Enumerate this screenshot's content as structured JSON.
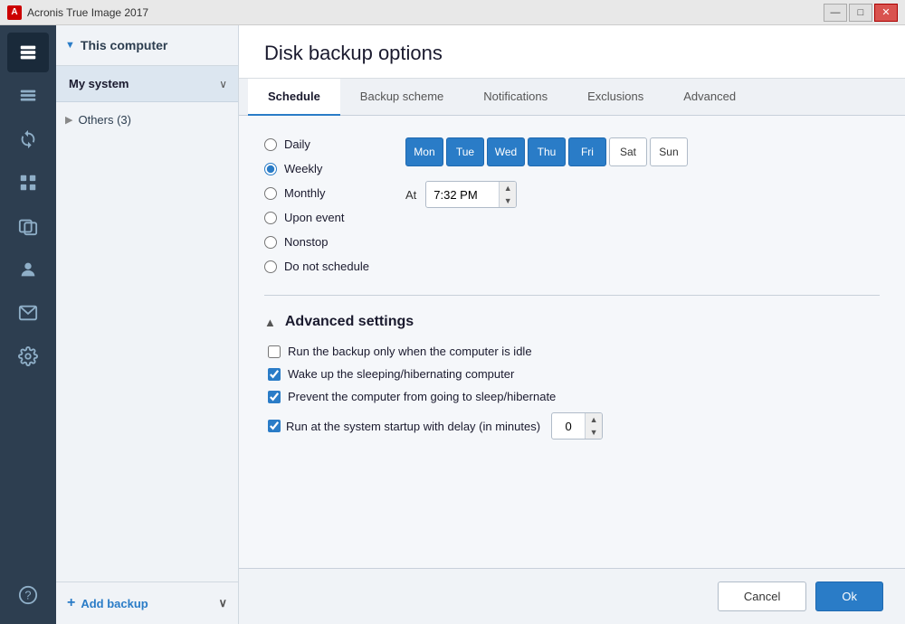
{
  "app": {
    "title": "Acronis True Image 2017",
    "icon_label": "A"
  },
  "titlebar": {
    "minimize_label": "—",
    "restore_label": "□",
    "close_label": "✕"
  },
  "sidebar": {
    "this_computer_label": "This computer",
    "arrow": "▼",
    "my_system_label": "My system",
    "others_label": "Others (3)",
    "add_backup_label": "Add backup"
  },
  "content": {
    "title": "Disk backup options"
  },
  "tabs": [
    {
      "id": "schedule",
      "label": "Schedule",
      "active": true
    },
    {
      "id": "backup-scheme",
      "label": "Backup scheme",
      "active": false
    },
    {
      "id": "notifications",
      "label": "Notifications",
      "active": false
    },
    {
      "id": "exclusions",
      "label": "Exclusions",
      "active": false
    },
    {
      "id": "advanced",
      "label": "Advanced",
      "active": false
    }
  ],
  "schedule": {
    "frequency_options": [
      {
        "id": "daily",
        "label": "Daily",
        "selected": false
      },
      {
        "id": "weekly",
        "label": "Weekly",
        "selected": true
      },
      {
        "id": "monthly",
        "label": "Monthly",
        "selected": false
      },
      {
        "id": "upon-event",
        "label": "Upon event",
        "selected": false
      },
      {
        "id": "nonstop",
        "label": "Nonstop",
        "selected": false
      },
      {
        "id": "do-not-schedule",
        "label": "Do not schedule",
        "selected": false
      }
    ],
    "days": [
      {
        "id": "mon",
        "label": "Mon",
        "active": true
      },
      {
        "id": "tue",
        "label": "Tue",
        "active": true
      },
      {
        "id": "wed",
        "label": "Wed",
        "active": true
      },
      {
        "id": "thu",
        "label": "Thu",
        "active": true
      },
      {
        "id": "fri",
        "label": "Fri",
        "active": true
      },
      {
        "id": "sat",
        "label": "Sat",
        "active": false
      },
      {
        "id": "sun",
        "label": "Sun",
        "active": false
      }
    ],
    "at_label": "At",
    "time_value": "7:32 PM"
  },
  "advanced_settings": {
    "title": "Advanced settings",
    "toggle_label": "▲",
    "options": [
      {
        "id": "idle-only",
        "label": "Run the backup only when the computer is idle",
        "checked": false
      },
      {
        "id": "wake-up",
        "label": "Wake up the sleeping/hibernating computer",
        "checked": true
      },
      {
        "id": "prevent-sleep",
        "label": "Prevent the computer from going to sleep/hibernate",
        "checked": true
      },
      {
        "id": "startup-delay",
        "label": "Run at the system startup with delay (in minutes)",
        "checked": true,
        "has_delay": true,
        "delay_value": "0"
      }
    ]
  },
  "footer": {
    "cancel_label": "Cancel",
    "ok_label": "Ok"
  }
}
